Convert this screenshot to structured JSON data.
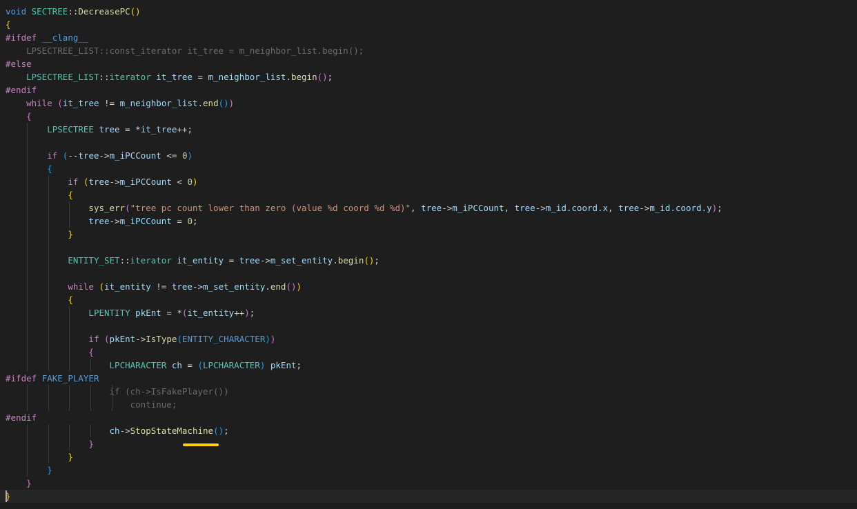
{
  "editor": {
    "language": "cpp",
    "theme": "dark",
    "lines": [
      [
        [
          "kw",
          "void"
        ],
        [
          "txt",
          " "
        ],
        [
          "ty",
          "SECTREE"
        ],
        [
          "txt",
          "::"
        ],
        [
          "fn",
          "DecreasePC"
        ],
        [
          "b1",
          "()"
        ]
      ],
      [
        [
          "b1",
          "{"
        ]
      ],
      [
        [
          "pp",
          "#ifdef"
        ],
        [
          "txt",
          " "
        ],
        [
          "mac",
          "__clang__"
        ]
      ],
      [
        [
          "in",
          "    "
        ],
        [
          "in",
          "LPSECTREE_LIST::const_iterator it_tree = m_neighbor_list.begin();"
        ]
      ],
      [
        [
          "pp",
          "#else"
        ]
      ],
      [
        [
          "txt",
          "    "
        ],
        [
          "ty",
          "LPSECTREE_LIST"
        ],
        [
          "txt",
          "::"
        ],
        [
          "ty",
          "iterator"
        ],
        [
          "txt",
          " "
        ],
        [
          "var",
          "it_tree"
        ],
        [
          "txt",
          " = "
        ],
        [
          "mem",
          "m_neighbor_list"
        ],
        [
          "txt",
          "."
        ],
        [
          "fn",
          "begin"
        ],
        [
          "b2",
          "()"
        ],
        [
          "txt",
          ";"
        ]
      ],
      [
        [
          "pp",
          "#endif"
        ]
      ],
      [
        [
          "txt",
          "    "
        ],
        [
          "ctl",
          "while"
        ],
        [
          "txt",
          " "
        ],
        [
          "b2",
          "("
        ],
        [
          "var",
          "it_tree"
        ],
        [
          "txt",
          " != "
        ],
        [
          "mem",
          "m_neighbor_list"
        ],
        [
          "txt",
          "."
        ],
        [
          "fn",
          "end"
        ],
        [
          "b3",
          "()"
        ],
        [
          "b2",
          ")"
        ]
      ],
      [
        [
          "txt",
          "    "
        ],
        [
          "b2",
          "{"
        ]
      ],
      [
        [
          "txt",
          "        "
        ],
        [
          "ty",
          "LPSECTREE"
        ],
        [
          "txt",
          " "
        ],
        [
          "var",
          "tree"
        ],
        [
          "txt",
          " = *"
        ],
        [
          "var",
          "it_tree"
        ],
        [
          "txt",
          "++;"
        ]
      ],
      [],
      [
        [
          "txt",
          "        "
        ],
        [
          "ctl",
          "if"
        ],
        [
          "txt",
          " "
        ],
        [
          "b3",
          "("
        ],
        [
          "txt",
          "--"
        ],
        [
          "var",
          "tree"
        ],
        [
          "txt",
          "->"
        ],
        [
          "mem",
          "m_iPCCount"
        ],
        [
          "txt",
          " <= "
        ],
        [
          "num",
          "0"
        ],
        [
          "b3",
          ")"
        ]
      ],
      [
        [
          "txt",
          "        "
        ],
        [
          "b3",
          "{"
        ]
      ],
      [
        [
          "txt",
          "            "
        ],
        [
          "ctl",
          "if"
        ],
        [
          "txt",
          " "
        ],
        [
          "b1",
          "("
        ],
        [
          "var",
          "tree"
        ],
        [
          "txt",
          "->"
        ],
        [
          "mem",
          "m_iPCCount"
        ],
        [
          "txt",
          " < "
        ],
        [
          "num",
          "0"
        ],
        [
          "b1",
          ")"
        ]
      ],
      [
        [
          "txt",
          "            "
        ],
        [
          "b1",
          "{"
        ]
      ],
      [
        [
          "txt",
          "                "
        ],
        [
          "fn",
          "sys_err"
        ],
        [
          "b2",
          "("
        ],
        [
          "str",
          "\"tree pc count lower than zero (value %d coord %d %d)\""
        ],
        [
          "txt",
          ", "
        ],
        [
          "var",
          "tree"
        ],
        [
          "txt",
          "->"
        ],
        [
          "mem",
          "m_iPCCount"
        ],
        [
          "txt",
          ", "
        ],
        [
          "var",
          "tree"
        ],
        [
          "txt",
          "->"
        ],
        [
          "mem",
          "m_id"
        ],
        [
          "txt",
          "."
        ],
        [
          "mem",
          "coord"
        ],
        [
          "txt",
          "."
        ],
        [
          "mem",
          "x"
        ],
        [
          "txt",
          ", "
        ],
        [
          "var",
          "tree"
        ],
        [
          "txt",
          "->"
        ],
        [
          "mem",
          "m_id"
        ],
        [
          "txt",
          "."
        ],
        [
          "mem",
          "coord"
        ],
        [
          "txt",
          "."
        ],
        [
          "mem",
          "y"
        ],
        [
          "b2",
          ")"
        ],
        [
          "txt",
          ";"
        ]
      ],
      [
        [
          "txt",
          "                "
        ],
        [
          "var",
          "tree"
        ],
        [
          "txt",
          "->"
        ],
        [
          "mem",
          "m_iPCCount"
        ],
        [
          "txt",
          " = "
        ],
        [
          "num",
          "0"
        ],
        [
          "txt",
          ";"
        ]
      ],
      [
        [
          "txt",
          "            "
        ],
        [
          "b1",
          "}"
        ]
      ],
      [],
      [
        [
          "txt",
          "            "
        ],
        [
          "ty",
          "ENTITY_SET"
        ],
        [
          "txt",
          "::"
        ],
        [
          "ty",
          "iterator"
        ],
        [
          "txt",
          " "
        ],
        [
          "var",
          "it_entity"
        ],
        [
          "txt",
          " = "
        ],
        [
          "var",
          "tree"
        ],
        [
          "txt",
          "->"
        ],
        [
          "mem",
          "m_set_entity"
        ],
        [
          "txt",
          "."
        ],
        [
          "fn",
          "begin"
        ],
        [
          "b1",
          "()"
        ],
        [
          "txt",
          ";"
        ]
      ],
      [],
      [
        [
          "txt",
          "            "
        ],
        [
          "ctl",
          "while"
        ],
        [
          "txt",
          " "
        ],
        [
          "b1",
          "("
        ],
        [
          "var",
          "it_entity"
        ],
        [
          "txt",
          " != "
        ],
        [
          "var",
          "tree"
        ],
        [
          "txt",
          "->"
        ],
        [
          "mem",
          "m_set_entity"
        ],
        [
          "txt",
          "."
        ],
        [
          "fn",
          "end"
        ],
        [
          "b2",
          "()"
        ],
        [
          "b1",
          ")"
        ]
      ],
      [
        [
          "txt",
          "            "
        ],
        [
          "b1",
          "{"
        ]
      ],
      [
        [
          "txt",
          "                "
        ],
        [
          "ty",
          "LPENTITY"
        ],
        [
          "txt",
          " "
        ],
        [
          "var",
          "pkEnt"
        ],
        [
          "txt",
          " = *"
        ],
        [
          "b2",
          "("
        ],
        [
          "var",
          "it_entity"
        ],
        [
          "txt",
          "++"
        ],
        [
          "b2",
          ")"
        ],
        [
          "txt",
          ";"
        ]
      ],
      [],
      [
        [
          "txt",
          "                "
        ],
        [
          "ctl",
          "if"
        ],
        [
          "txt",
          " "
        ],
        [
          "b2",
          "("
        ],
        [
          "var",
          "pkEnt"
        ],
        [
          "txt",
          "->"
        ],
        [
          "fn",
          "IsType"
        ],
        [
          "b3",
          "("
        ],
        [
          "mac",
          "ENTITY_CHARACTER"
        ],
        [
          "b3",
          ")"
        ],
        [
          "b2",
          ")"
        ]
      ],
      [
        [
          "txt",
          "                "
        ],
        [
          "b2",
          "{"
        ]
      ],
      [
        [
          "txt",
          "                    "
        ],
        [
          "ty",
          "LPCHARACTER"
        ],
        [
          "txt",
          " "
        ],
        [
          "var",
          "ch"
        ],
        [
          "txt",
          " = "
        ],
        [
          "b3",
          "("
        ],
        [
          "ty",
          "LPCHARACTER"
        ],
        [
          "b3",
          ")"
        ],
        [
          "txt",
          " "
        ],
        [
          "var",
          "pkEnt"
        ],
        [
          "txt",
          ";"
        ]
      ],
      [
        [
          "pp",
          "#ifdef"
        ],
        [
          "txt",
          " "
        ],
        [
          "mac",
          "FAKE_PLAYER"
        ]
      ],
      [
        [
          "in",
          "                    if (ch->IsFakePlayer())"
        ]
      ],
      [
        [
          "in",
          "                        continue;"
        ]
      ],
      [
        [
          "pp",
          "#endif"
        ]
      ],
      [
        [
          "txt",
          "                    "
        ],
        [
          "var",
          "ch"
        ],
        [
          "txt",
          "->"
        ],
        [
          "fn",
          "StopStateMachine"
        ],
        [
          "b3",
          "()"
        ],
        [
          "txt",
          ";"
        ]
      ],
      [
        [
          "txt",
          "                "
        ],
        [
          "b2",
          "}"
        ]
      ],
      [
        [
          "txt",
          "            "
        ],
        [
          "b1",
          "}"
        ]
      ],
      [
        [
          "txt",
          "        "
        ],
        [
          "b3",
          "}"
        ]
      ],
      [
        [
          "txt",
          "    "
        ],
        [
          "b2",
          "}"
        ]
      ],
      [
        [
          "b1",
          "}"
        ]
      ]
    ],
    "current_line": 37,
    "highlight_color": "#ffd200"
  }
}
